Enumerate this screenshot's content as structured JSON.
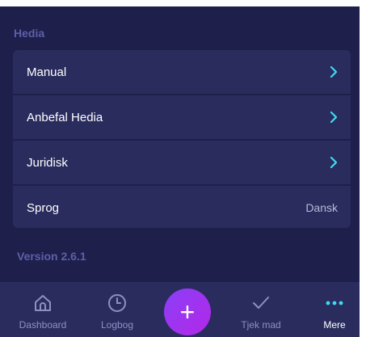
{
  "section": {
    "title": "Hedia"
  },
  "rows": [
    {
      "label": "Manual",
      "icon": "chevron-right-icon"
    },
    {
      "label": "Anbefal Hedia",
      "icon": "chevron-right-icon"
    },
    {
      "label": "Juridisk",
      "icon": "chevron-right-icon"
    },
    {
      "label": "Sprog",
      "value": "Dansk"
    }
  ],
  "version": "Version 2.6.1",
  "tabs": [
    {
      "label": "Dashboard",
      "icon": "home-icon"
    },
    {
      "label": "Logbog",
      "icon": "clock-icon"
    },
    {
      "label": "",
      "icon": "plus-icon"
    },
    {
      "label": "Tjek mad",
      "icon": "check-icon"
    },
    {
      "label": "Mere",
      "icon": "more-dots-icon"
    }
  ],
  "fab": {
    "symbol": "+"
  },
  "colors": {
    "background": "#1e1f4b",
    "card": "#2a2c5e",
    "accent": "#3ddcf0",
    "section_text": "#5d60a8",
    "fab_gradient_start": "#8b3ff7",
    "fab_gradient_end": "#b228e8"
  }
}
